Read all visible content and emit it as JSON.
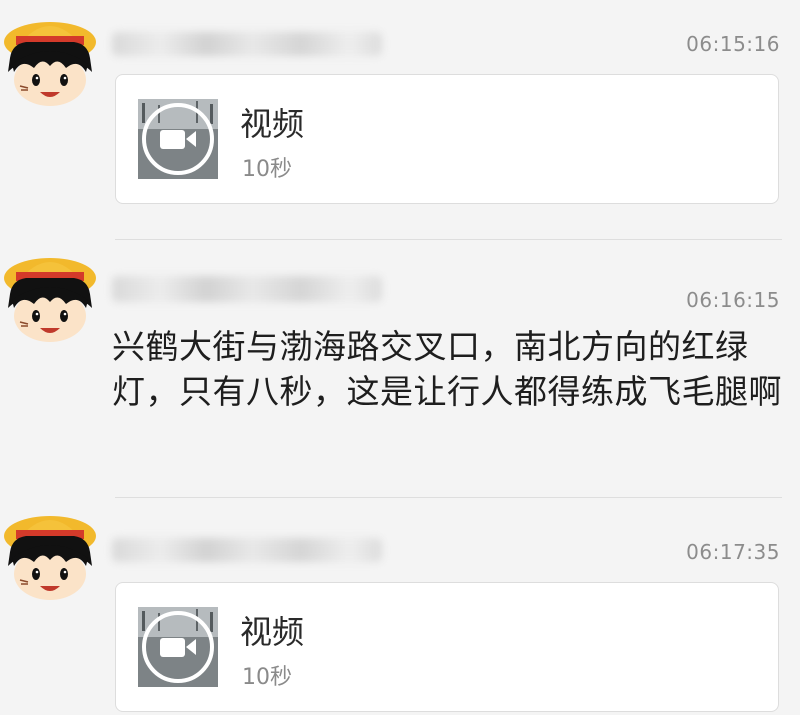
{
  "messages": [
    {
      "type": "video",
      "time": "06:15:16",
      "video": {
        "label": "视频",
        "duration": "10秒"
      }
    },
    {
      "type": "text",
      "time": "06:16:15",
      "text": "兴鹤大街与渤海路交叉口，南北方向的红绿灯，只有八秒，这是让行人都得练成飞毛腿啊"
    },
    {
      "type": "video",
      "time": "06:17:35",
      "video": {
        "label": "视频",
        "duration": "10秒"
      }
    }
  ],
  "icons": {
    "avatar": "cartoon-straw-hat-boy-avatar",
    "video_play": "video-camera-play-icon"
  },
  "colors": {
    "background": "#f4f4f4",
    "card": "#ffffff",
    "timestamp": "#8c8c8c",
    "hat": "#f2b92c",
    "hat_band": "#d43a2a"
  }
}
